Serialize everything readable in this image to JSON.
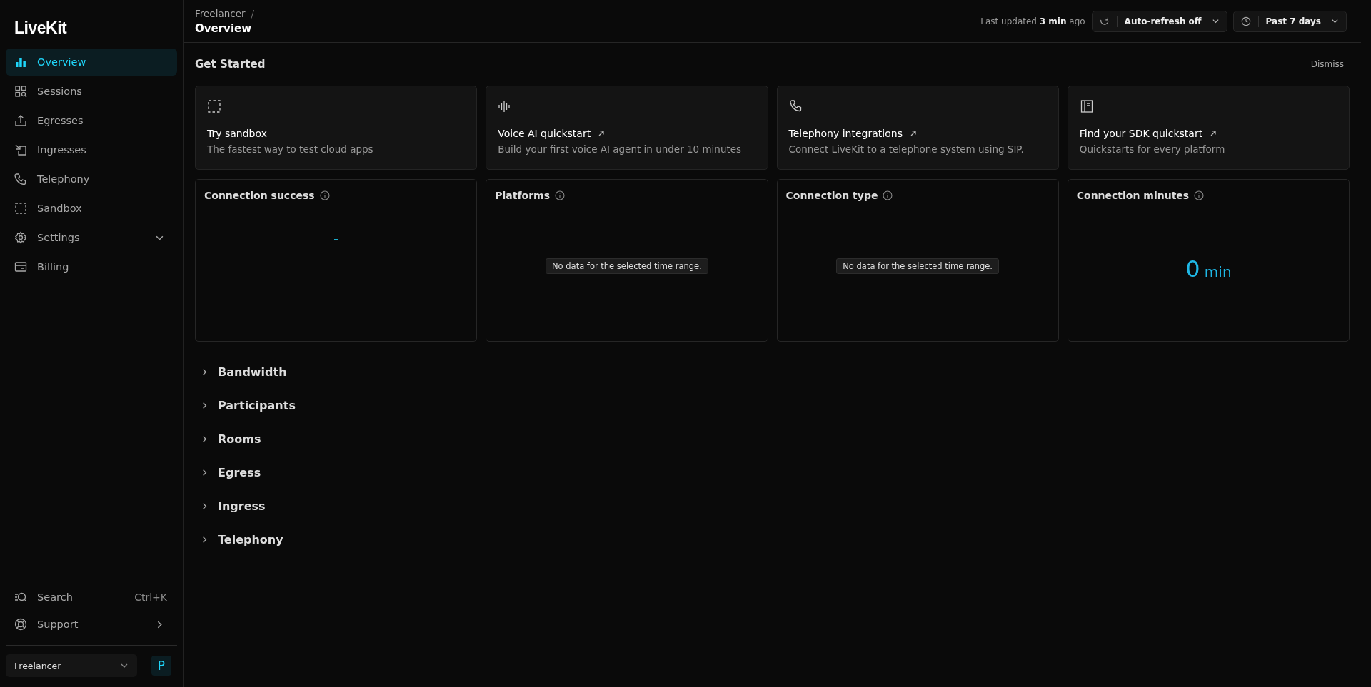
{
  "sidebar": {
    "logo": "LiveKit",
    "items": [
      {
        "label": "Overview",
        "selected": true,
        "expandable": false
      },
      {
        "label": "Sessions",
        "selected": false,
        "expandable": false
      },
      {
        "label": "Egresses",
        "selected": false,
        "expandable": false
      },
      {
        "label": "Ingresses",
        "selected": false,
        "expandable": false
      },
      {
        "label": "Telephony",
        "selected": false,
        "expandable": false
      },
      {
        "label": "Sandbox",
        "selected": false,
        "expandable": false
      },
      {
        "label": "Settings",
        "selected": false,
        "expandable": true
      },
      {
        "label": "Billing",
        "selected": false,
        "expandable": false
      }
    ],
    "search": {
      "label": "Search",
      "shortcut": "Ctrl+K"
    },
    "support": {
      "label": "Support"
    },
    "workspace": {
      "name": "Freelancer",
      "avatar": "P"
    }
  },
  "header": {
    "breadcrumb": "Freelancer",
    "separator": "/",
    "title": "Overview",
    "last_updated": "Last updated **3 min** ago",
    "auto_refresh": "Auto-refresh off",
    "range": "Past 7 days"
  },
  "get_started": {
    "title": "Get Started",
    "dismiss": "Dismiss",
    "cards": [
      {
        "title": "Try sandbox",
        "description": "The fastest way to test cloud apps",
        "external": false
      },
      {
        "title": "Voice AI quickstart",
        "description": "Build your first voice AI agent in under 10 minutes",
        "external": true
      },
      {
        "title": "Telephony integrations",
        "description": "Connect LiveKit to a telephone system using SIP.",
        "external": true
      },
      {
        "title": "Find your SDK quickstart",
        "description": "Quickstarts for every platform",
        "external": true
      }
    ]
  },
  "metrics": [
    {
      "title": "Connection success",
      "kind": "dash",
      "text": "–"
    },
    {
      "title": "Platforms",
      "kind": "empty",
      "text": "No data for the selected time range."
    },
    {
      "title": "Connection type",
      "kind": "empty",
      "text": "No data for the selected time range."
    },
    {
      "title": "Connection minutes",
      "kind": "value",
      "text": "0",
      "unit": "min"
    }
  ],
  "sections": [
    {
      "label": "Bandwidth",
      "expanded": false
    },
    {
      "label": "Participants",
      "expanded": false
    },
    {
      "label": "Rooms",
      "expanded": false
    },
    {
      "label": "Egress",
      "expanded": false
    },
    {
      "label": "Ingress",
      "expanded": false
    },
    {
      "label": "Telephony",
      "expanded": false
    }
  ]
}
